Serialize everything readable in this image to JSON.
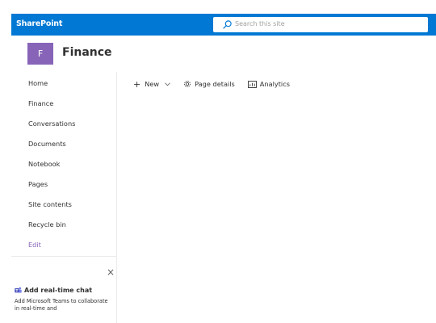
{
  "suite_bar": {
    "brand": "SharePoint",
    "search_placeholder": "Search this site",
    "icons": {
      "search": "search-icon"
    }
  },
  "site": {
    "logo_letter": "F",
    "title": "Finance",
    "logo_color": "#8764b8"
  },
  "nav": {
    "items": [
      {
        "label": "Home"
      },
      {
        "label": "Finance"
      },
      {
        "label": "Conversations"
      },
      {
        "label": "Documents"
      },
      {
        "label": "Notebook"
      },
      {
        "label": "Pages"
      },
      {
        "label": "Site contents"
      },
      {
        "label": "Recycle bin"
      }
    ],
    "edit_label": "Edit"
  },
  "teams_card": {
    "title": "Add real-time chat",
    "description": "Add Microsoft Teams to collaborate in real-time and",
    "close_label": "×",
    "icons": {
      "teams": "teams-icon",
      "close": "close-icon"
    }
  },
  "command_bar": {
    "new_label": "New",
    "page_details_label": "Page details",
    "analytics_label": "Analytics",
    "icons": {
      "new": "plus-icon",
      "chevron": "chevron-down-icon",
      "page_details": "gear-icon",
      "analytics": "analytics-icon"
    }
  },
  "colors": {
    "suite_bar": "#0078d4",
    "accent_purple": "#8764b8"
  }
}
